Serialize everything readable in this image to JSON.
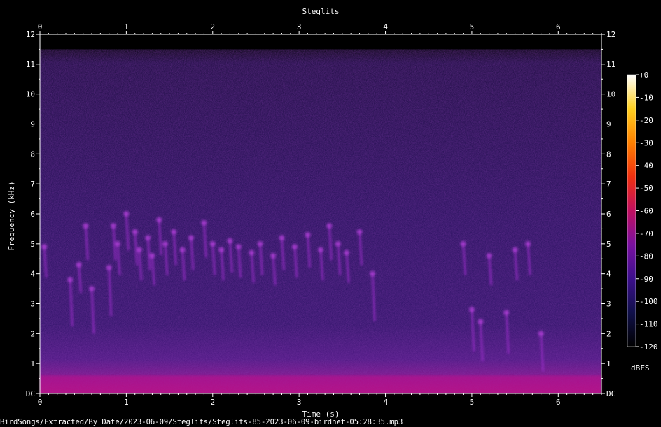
{
  "chart_data": {
    "type": "heatmap",
    "title": "Steglits",
    "xlabel": "Time (s)",
    "ylabel": "Frequency (kHz)",
    "xlim": [
      0,
      6.5
    ],
    "ylim": [
      0,
      12
    ],
    "x_ticks": [
      "0",
      "1",
      "2",
      "3",
      "4",
      "5",
      "6"
    ],
    "y_ticks": [
      "DC",
      "1",
      "2",
      "3",
      "4",
      "5",
      "6",
      "7",
      "8",
      "9",
      "10",
      "11",
      "12"
    ],
    "colorbar": {
      "label": "dBFS",
      "ticks": [
        "+0",
        "-10",
        "-20",
        "-30",
        "-40",
        "-50",
        "-60",
        "-70",
        "-80",
        "-90",
        "-100",
        "-110",
        "-120"
      ],
      "range": [
        -120,
        0
      ],
      "colors": [
        "#000000",
        "#10104a",
        "#3c0f8c",
        "#7a10a0",
        "#c01060",
        "#f03010",
        "#ff8000",
        "#ffd020",
        "#ffffff"
      ]
    },
    "series": [
      {
        "values": []
      }
    ],
    "background_noise_ceiling_khz": 11.5,
    "low_freq_band_khz": [
      0,
      1.0
    ],
    "calls": [
      {
        "t": 0.05,
        "f": 4.9
      },
      {
        "t": 0.35,
        "f": 3.8
      },
      {
        "t": 0.45,
        "f": 4.3
      },
      {
        "t": 0.53,
        "f": 5.6
      },
      {
        "t": 0.6,
        "f": 3.5
      },
      {
        "t": 0.8,
        "f": 4.2
      },
      {
        "t": 0.85,
        "f": 5.6
      },
      {
        "t": 0.9,
        "f": 5.0
      },
      {
        "t": 1.0,
        "f": 6.0
      },
      {
        "t": 1.1,
        "f": 5.4
      },
      {
        "t": 1.15,
        "f": 4.8
      },
      {
        "t": 1.25,
        "f": 5.2
      },
      {
        "t": 1.3,
        "f": 4.6
      },
      {
        "t": 1.38,
        "f": 5.8
      },
      {
        "t": 1.45,
        "f": 5.0
      },
      {
        "t": 1.55,
        "f": 5.4
      },
      {
        "t": 1.65,
        "f": 4.8
      },
      {
        "t": 1.75,
        "f": 5.2
      },
      {
        "t": 1.9,
        "f": 5.7
      },
      {
        "t": 2.0,
        "f": 5.0
      },
      {
        "t": 2.1,
        "f": 4.8
      },
      {
        "t": 2.2,
        "f": 5.1
      },
      {
        "t": 2.3,
        "f": 4.9
      },
      {
        "t": 2.45,
        "f": 4.7
      },
      {
        "t": 2.55,
        "f": 5.0
      },
      {
        "t": 2.7,
        "f": 4.6
      },
      {
        "t": 2.8,
        "f": 5.2
      },
      {
        "t": 2.95,
        "f": 4.9
      },
      {
        "t": 3.1,
        "f": 5.3
      },
      {
        "t": 3.25,
        "f": 4.8
      },
      {
        "t": 3.35,
        "f": 5.6
      },
      {
        "t": 3.45,
        "f": 5.0
      },
      {
        "t": 3.55,
        "f": 4.7
      },
      {
        "t": 3.7,
        "f": 5.4
      },
      {
        "t": 3.85,
        "f": 4.0
      },
      {
        "t": 4.9,
        "f": 5.0
      },
      {
        "t": 5.0,
        "f": 2.8
      },
      {
        "t": 5.1,
        "f": 2.4
      },
      {
        "t": 5.2,
        "f": 4.6
      },
      {
        "t": 5.4,
        "f": 2.7
      },
      {
        "t": 5.5,
        "f": 4.8
      },
      {
        "t": 5.65,
        "f": 5.0
      },
      {
        "t": 5.8,
        "f": 2.0
      }
    ]
  },
  "footer_path": "BirdSongs/Extracted/By_Date/2023-06-09/Steglits/Steglits-85-2023-06-09-birdnet-05:28:35.mp3"
}
